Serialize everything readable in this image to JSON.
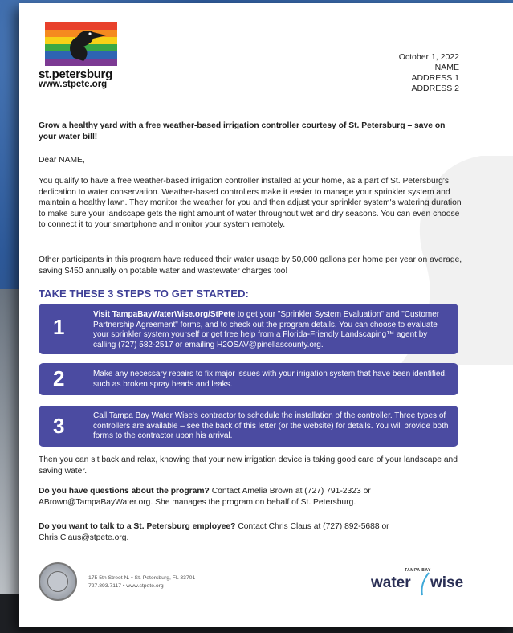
{
  "logo": {
    "name": "st.petersburg",
    "url": "www.stpete.org",
    "stripe_colors": [
      "#e8412b",
      "#f58a1f",
      "#f7d117",
      "#3aa845",
      "#2e64b3",
      "#7c3a93"
    ]
  },
  "letter": {
    "date": "October 1, 2022",
    "address": [
      "NAME",
      "ADDRESS 1",
      "ADDRESS 2"
    ],
    "intro": "Grow a healthy yard with a free weather-based irrigation controller courtesy of St. Petersburg – save on your water bill!",
    "salutation": "Dear NAME,",
    "para1": "You qualify to have a free weather-based irrigation controller installed at your home, as a part of St. Petersburg's dedication to water conservation. Weather-based controllers make it easier to manage your sprinkler system and maintain a healthy lawn. They monitor the weather for you and then adjust your sprinkler system's watering duration to make sure your landscape gets the right amount of water throughout wet and dry seasons. You can even choose to connect it to your smartphone and monitor your system remotely.",
    "para2": "Other participants in this program have reduced their water usage by 50,000 gallons per home per year on average, saving $450 annually on potable water and wastewater charges too!",
    "steps_heading": "TAKE THESE 3 STEPS TO GET STARTED:",
    "steps": [
      {
        "num": "1",
        "text_prefix": "Visit ",
        "link": "TampaBayWaterWise.org/StPete",
        "text_rest": " to get your \"Sprinkler System Evaluation\" and \"Customer Partnership Agreement\" forms, and to check out the program details. You can choose to evaluate your sprinkler system yourself or get free help from a Florida-Friendly Landscaping™ agent by calling (727) 582-2517 or emailing H2OSAV@pinellascounty.org."
      },
      {
        "num": "2",
        "text": "Make any necessary repairs to fix major issues with your irrigation system that have been identified, such as broken spray heads and leaks."
      },
      {
        "num": "3",
        "text": "Call Tampa Bay Water Wise's contractor to schedule the installation of the controller. Three types of controllers are available – see the back of this letter (or the website) for details. You will provide both forms to the contractor upon his arrival."
      }
    ],
    "para3": "Then you can sit back and relax, knowing that your new irrigation device is taking good care of your landscape and saving water.",
    "q1_bold": "Do you have questions about the program?",
    "q1_rest": " Contact Amelia Brown at (727) 791-2323 or ABrown@TampaBayWater.org. She manages the program on behalf of St. Petersburg.",
    "q2_bold": "Do you want to talk to a St. Petersburg employee?",
    "q2_rest": "  Contact Chris Claus at (727) 892-5688 or Chris.Claus@stpete.org."
  },
  "footer": {
    "address_line1": "175 5th Street N. • St. Petersburg, FL 33701",
    "address_line2": "727.893.7117 • www.stpete.org",
    "brand_top": "TAMPA BAY",
    "brand_left": "water",
    "brand_right": "wise",
    "brand_color": "#2a2f55",
    "accent_color": "#3fa9d9"
  },
  "colors": {
    "step_box": "#4b4ba1",
    "heading": "#3e3f96"
  }
}
